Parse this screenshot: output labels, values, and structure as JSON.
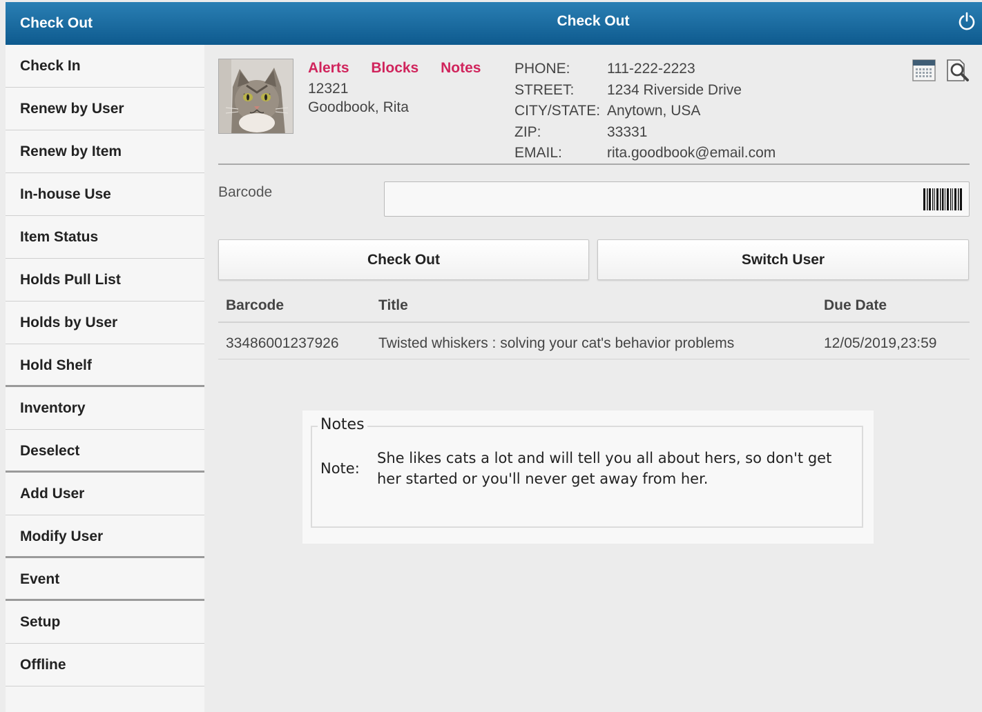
{
  "sidebar": {
    "active": "Check Out",
    "items": [
      {
        "label": "Check In"
      },
      {
        "label": "Renew by User"
      },
      {
        "label": "Renew by Item"
      },
      {
        "label": "In-house Use"
      },
      {
        "label": "Item Status"
      },
      {
        "label": "Holds Pull List"
      },
      {
        "label": "Holds by User"
      },
      {
        "label": "Hold Shelf"
      },
      {
        "label": "Inventory"
      },
      {
        "label": "Deselect"
      },
      {
        "label": "Add User"
      },
      {
        "label": "Modify User"
      },
      {
        "label": "Event"
      },
      {
        "label": "Setup"
      },
      {
        "label": "Offline"
      }
    ]
  },
  "header": {
    "title": "Check Out"
  },
  "user": {
    "links": {
      "alerts": "Alerts",
      "blocks": "Blocks",
      "notes": "Notes"
    },
    "id": "12321",
    "name": "Goodbook, Rita",
    "contact": [
      {
        "label": "PHONE:",
        "value": "111-222-2223"
      },
      {
        "label": "STREET:",
        "value": "1234 Riverside Drive"
      },
      {
        "label": "CITY/STATE:",
        "value": "Anytown, USA"
      },
      {
        "label": "ZIP:",
        "value": "33331"
      },
      {
        "label": "EMAIL:",
        "value": "rita.goodbook@email.com"
      }
    ]
  },
  "barcode": {
    "label": "Barcode",
    "value": ""
  },
  "buttons": {
    "checkout": "Check Out",
    "switch_user": "Switch User"
  },
  "table": {
    "headers": {
      "barcode": "Barcode",
      "title": "Title",
      "due": "Due Date"
    },
    "rows": [
      {
        "barcode": "33486001237926",
        "title": "Twisted whiskers : solving your cat's behavior problems",
        "due": "12/05/2019,23:59"
      }
    ]
  },
  "notes": {
    "legend": "Notes",
    "label": "Note:",
    "text": "She likes cats a lot and will tell you all about hers, so don't get her started or you'll never get away from her."
  },
  "colors": {
    "header_top": "#2a7fb4",
    "header_bottom": "#0e5a8e",
    "link": "#d0245c"
  },
  "icons": [
    "power-icon",
    "calendar-icon",
    "search-document-icon",
    "barcode-icon",
    "user-photo"
  ]
}
